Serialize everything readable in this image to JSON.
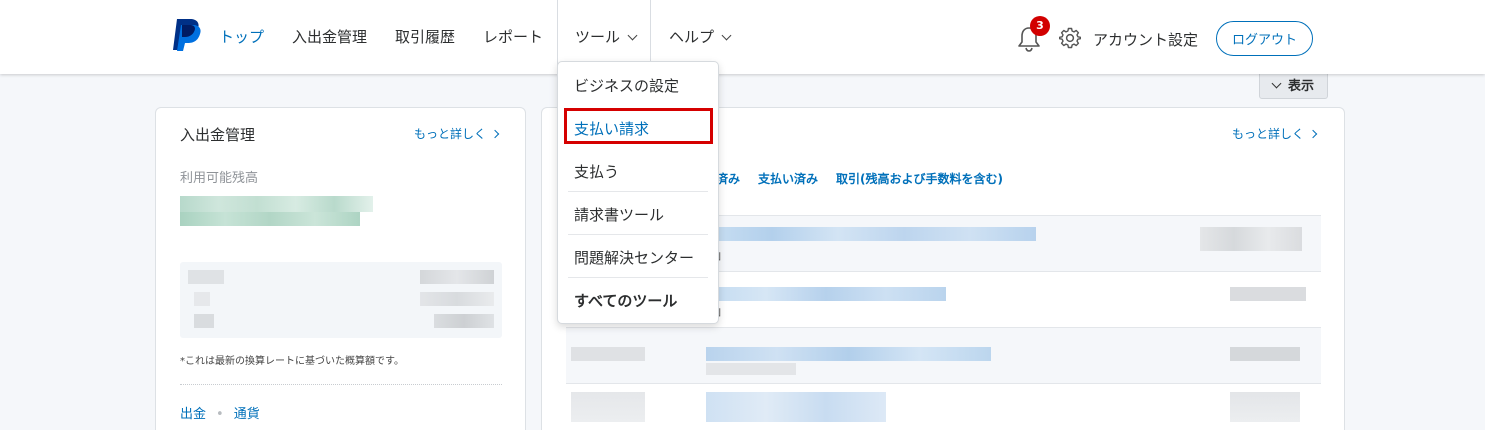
{
  "header": {
    "nav": [
      "トップ",
      "入出金管理",
      "取引履歴",
      "レポート",
      "ツール",
      "ヘルプ"
    ],
    "notification_count": "3",
    "account_label": "アカウント設定",
    "logout_label": "ログアウト"
  },
  "show_button_label": "表示",
  "tools_menu": {
    "items": [
      "ビジネスの設定",
      "支払い請求",
      "支払う",
      "請求書ツール",
      "問題解決センター",
      "すべてのツール"
    ],
    "selected": "支払い請求"
  },
  "balance_card": {
    "title": "入出金管理",
    "more_link": "もっと詳しく",
    "available_label": "利用可能残高",
    "note": "*これは最新の換算レートに基づいた概算額です。",
    "links": [
      "出金",
      "通貨"
    ]
  },
  "activity_card": {
    "more_link": "もっと詳しく",
    "tabs": [
      "済み",
      "支払い済み",
      "取引(残高および手数料を含む)"
    ],
    "row_fragment": "」"
  },
  "colors": {
    "brand_blue": "#0070ba",
    "badge_red": "#d20000",
    "highlight_red": "#d50000"
  }
}
